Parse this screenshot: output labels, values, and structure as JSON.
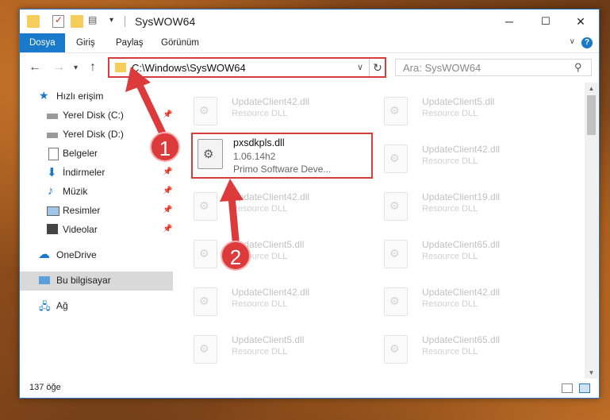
{
  "window": {
    "title": "SysWOW64",
    "controls": {
      "minimize": "─",
      "maximize": "☐",
      "close": "✕"
    }
  },
  "ribbon": {
    "tabs": [
      "Dosya",
      "Giriş",
      "Paylaş",
      "Görünüm"
    ],
    "help": "?"
  },
  "nav": {
    "back": "←",
    "forward": "→",
    "up": "↑",
    "address": "C:\\Windows\\SysWOW64",
    "search_placeholder": "Ara: SysWOW64"
  },
  "sidebar": {
    "quick_access": "Hızlı erişim",
    "items": [
      {
        "label": "Yerel Disk (C:)",
        "icon": "drive-icon",
        "pinned": true
      },
      {
        "label": "Yerel Disk (D:)",
        "icon": "drive-icon",
        "pinned": false
      },
      {
        "label": "Belgeler",
        "icon": "documents-icon",
        "pinned": true
      },
      {
        "label": "İndirmeler",
        "icon": "downloads-icon",
        "pinned": true
      },
      {
        "label": "Müzik",
        "icon": "music-icon",
        "pinned": true
      },
      {
        "label": "Resimler",
        "icon": "pictures-icon",
        "pinned": true
      },
      {
        "label": "Videolar",
        "icon": "videos-icon",
        "pinned": true
      }
    ],
    "onedrive": "OneDrive",
    "this_pc": "Bu bilgisayar",
    "network": "Ağ"
  },
  "files": [
    {
      "name": "UpdateClient42.dll",
      "type": "Resource DLL"
    },
    {
      "name": "UpdateClient5.dll",
      "type": "Resource DLL"
    },
    {
      "name": "UpdateClient42.dll",
      "type": "Resource DLL"
    },
    {
      "name": "UpdateClient42.dll",
      "type": "Resource DLL"
    },
    {
      "name": "UpdateClient19.dll",
      "type": "Resource DLL"
    },
    {
      "name": "UpdateClient5.dll",
      "type": "Resource DLL"
    },
    {
      "name": "UpdateClient65.dll",
      "type": "Resource DLL"
    },
    {
      "name": "UpdateClient42.dll",
      "type": "Resource DLL"
    },
    {
      "name": "UpdateClient42.dll",
      "type": "Resource DLL"
    },
    {
      "name": "UpdateClient5.dll",
      "type": "Resource DLL"
    },
    {
      "name": "UpdateClient65.dll",
      "type": "Resource DLL"
    }
  ],
  "highlighted_file": {
    "name": "pxsdkpls.dll",
    "version": "1.06.14h2",
    "company": "Primo Software Deve..."
  },
  "status": {
    "count": "137 öğe"
  },
  "annotations": {
    "step1": "1",
    "step2": "2"
  },
  "colors": {
    "accent": "#1979ca",
    "highlight": "#d93c3c"
  }
}
